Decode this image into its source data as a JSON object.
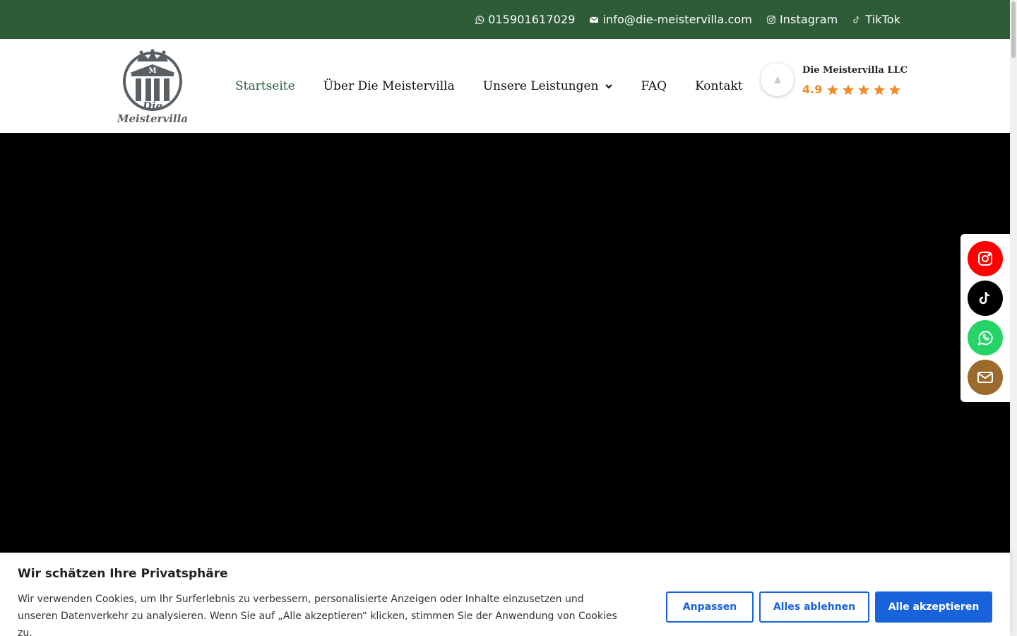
{
  "topbar": {
    "phone": "015901617029",
    "email": "info@die-meistervilla.com",
    "instagram": "Instagram",
    "tiktok": "TikTok"
  },
  "logo": {
    "text": "Die Meistervilla",
    "monogram": "M"
  },
  "nav": [
    {
      "label": "Startseite",
      "active": true
    },
    {
      "label": "Über Die Meistervilla"
    },
    {
      "label": "Unsere Leistungen",
      "dropdown": true
    },
    {
      "label": "FAQ"
    },
    {
      "label": "Kontakt"
    }
  ],
  "rating": {
    "name": "Die Meistervilla LLC",
    "score": "4.9",
    "stars": 5
  },
  "float_social": [
    "instagram-icon",
    "tiktok-icon",
    "whatsapp-icon",
    "mail-icon"
  ],
  "colors": {
    "brand_green": "#2f5c38",
    "instagram": "#ff0000",
    "tiktok": "#000000",
    "whatsapp": "#25d366",
    "mail": "#9b6a2c",
    "cookie_blue": "#1863dc",
    "star": "#f28c28"
  },
  "cookie": {
    "title": "Wir schätzen Ihre Privatsphäre",
    "text": "Wir verwenden Cookies, um Ihr Surferlebnis zu verbessern, personalisierte Anzeigen oder Inhalte einzusetzen und unseren Datenverkehr zu analysieren. Wenn Sie auf „Alle akzeptieren“ klicken, stimmen Sie der Anwendung von Cookies zu.",
    "customize": "Anpassen",
    "reject": "Alles ablehnen",
    "accept": "Alle akzeptieren"
  }
}
